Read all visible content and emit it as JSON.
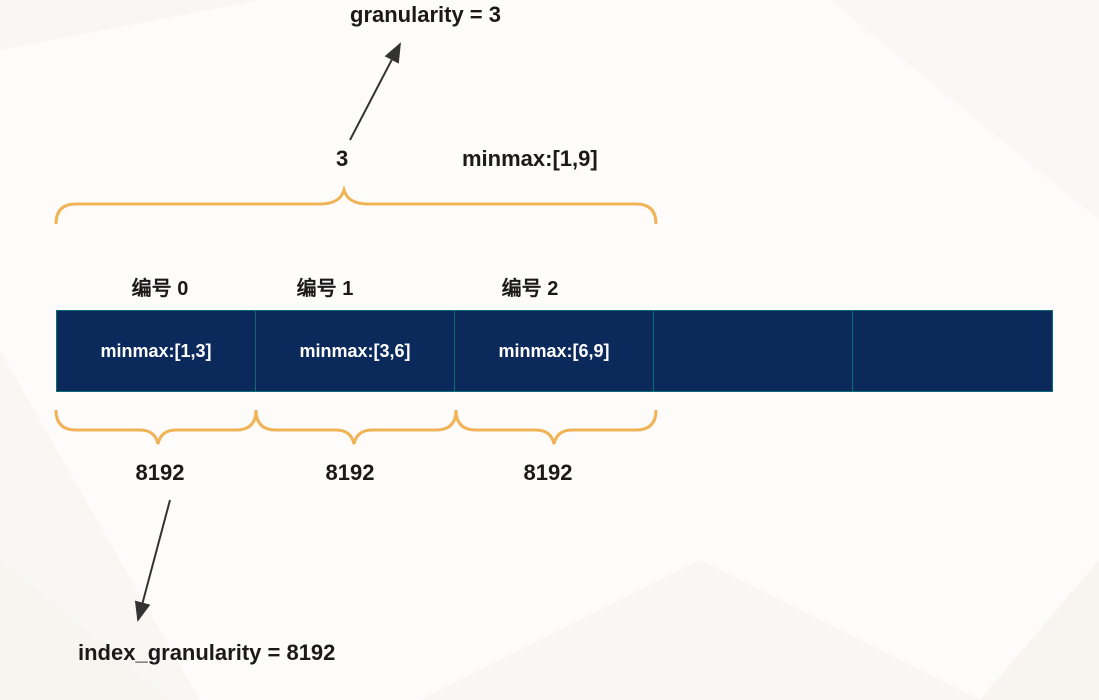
{
  "top": {
    "granularity_label": "granularity = 3",
    "three": "3",
    "minmax_full": "minmax:[1,9]"
  },
  "blocks": [
    {
      "label": "编号 0",
      "minmax": "minmax:[1,3]",
      "size": "8192"
    },
    {
      "label": "编号 1",
      "minmax": "minmax:[3,6]",
      "size": "8192"
    },
    {
      "label": "编号 2",
      "minmax": "minmax:[6,9]",
      "size": "8192"
    }
  ],
  "bottom": {
    "index_granularity_label": "index_granularity = 8192"
  },
  "colors": {
    "cell_bg": "#0b2a5b",
    "cell_border": "#0a6c74",
    "brace": "#f0b457",
    "arrow": "#333333"
  }
}
